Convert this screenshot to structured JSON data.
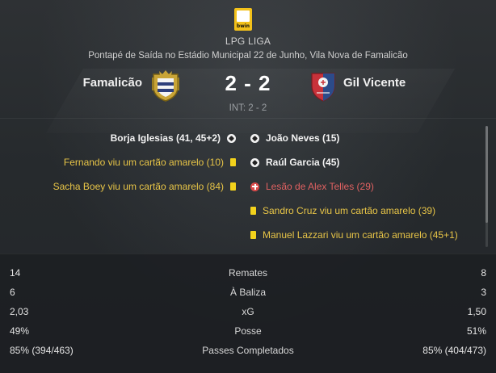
{
  "match": {
    "league": "LPG LIGA",
    "league_logo_text": "bwin",
    "venue": "Pontapé de Saída no Estádio Municipal 22 de Junho, Vila Nova de Famalicão",
    "home_team": "Famalicão",
    "away_team": "Gil Vicente",
    "score": "2 - 2",
    "interval": "INT: 2 - 2"
  },
  "events": {
    "home": [
      {
        "type": "goal",
        "icon": "ball-icon",
        "text": "Borja Iglesias (41, 45+2)"
      },
      {
        "type": "yellow",
        "icon": "yellow-card-icon",
        "text": "Fernando viu um cartão amarelo (10)"
      },
      {
        "type": "yellow",
        "icon": "yellow-card-icon",
        "text": "Sacha Boey viu um cartão amarelo (84)"
      }
    ],
    "away": [
      {
        "type": "goal",
        "icon": "ball-icon",
        "text": "João Neves (15)"
      },
      {
        "type": "goal",
        "icon": "ball-icon",
        "text": "Raúl Garcia (45)"
      },
      {
        "type": "injury",
        "icon": "injury-cross-icon",
        "text": "Lesão de Alex Telles (29)"
      },
      {
        "type": "yellow",
        "icon": "yellow-card-icon",
        "text": "Sandro Cruz viu um cartão amarelo (39)"
      },
      {
        "type": "yellow",
        "icon": "yellow-card-icon",
        "text": "Manuel Lazzari viu um cartão amarelo (45+1)"
      }
    ]
  },
  "stats": [
    {
      "label": "Remates",
      "home": "14",
      "away": "8"
    },
    {
      "label": "À Baliza",
      "home": "6",
      "away": "3"
    },
    {
      "label": "xG",
      "home": "2,03",
      "away": "1,50"
    },
    {
      "label": "Posse",
      "home": "49%",
      "away": "51%"
    },
    {
      "label": "Passes Completados",
      "home": "85% (394/463)",
      "away": "85% (404/473)"
    }
  ],
  "colors": {
    "goal_text": "#f2f2f2",
    "yellow_text": "#e8c547",
    "injury_text": "#e06161",
    "card": "#f3d21c",
    "home_crest_gold": "#c9a437",
    "away_crest_red": "#c8323a",
    "away_crest_blue": "#2c4b8a"
  }
}
